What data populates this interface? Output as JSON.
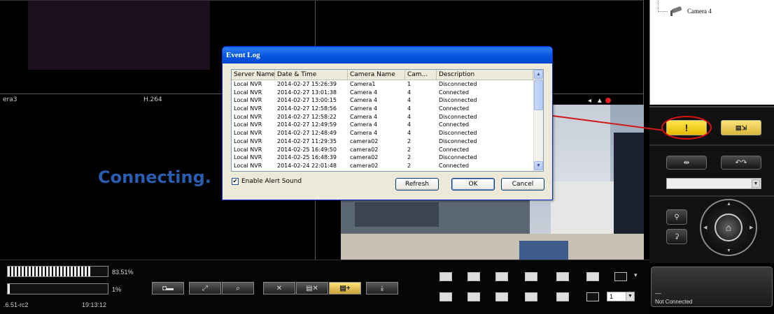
{
  "cameras": {
    "cam3_label": "era3",
    "cam3_codec": "H.264",
    "cam3_status": "Connecting."
  },
  "device_tree": {
    "item": "Camera 4"
  },
  "dialog": {
    "title": "Event Log",
    "columns": [
      "Server Name",
      "Date & Time",
      "Camera Name",
      "Cam...",
      "Description"
    ],
    "rows": [
      [
        "Local NVR",
        "2014-02-27 15:26:39",
        "Camera1",
        "1",
        "Disconnected"
      ],
      [
        "Local NVR",
        "2014-02-27 13:01:38",
        "Camera 4",
        "4",
        "Connected"
      ],
      [
        "Local NVR",
        "2014-02-27 13:00:15",
        "Camera 4",
        "4",
        "Disconnected"
      ],
      [
        "Local NVR",
        "2014-02-27 12:58:56",
        "Camera 4",
        "4",
        "Connected"
      ],
      [
        "Local NVR",
        "2014-02-27 12:58:22",
        "Camera 4",
        "4",
        "Disconnected"
      ],
      [
        "Local NVR",
        "2014-02-27 12:49:59",
        "Camera 4",
        "4",
        "Connected"
      ],
      [
        "Local NVR",
        "2014-02-27 12:48:49",
        "Camera 4",
        "4",
        "Disconnected"
      ],
      [
        "Local NVR",
        "2014-02-27 11:29:35",
        "camera02",
        "2",
        "Disconnected"
      ],
      [
        "Local NVR",
        "2014-02-25 16:49:50",
        "camera02",
        "2",
        "Connected"
      ],
      [
        "Local NVR",
        "2014-02-25 16:48:39",
        "camera02",
        "2",
        "Disconnected"
      ],
      [
        "Local NVR",
        "2014-02-24 22:01:48",
        "camera02",
        "2",
        "Connected"
      ]
    ],
    "checkbox_label": "Enable Alert Sound",
    "checkbox_checked": true,
    "refresh_label": "Refresh",
    "ok_label": "OK",
    "cancel_label": "Cancel"
  },
  "meters": {
    "top_percent_text": "83.51%",
    "top_value": 0.8351,
    "bottom_percent_text": "1%",
    "bottom_value": 0.01
  },
  "footer": {
    "version": ".6.51-rc2",
    "clock": "19:13:12"
  },
  "controls": {
    "alert_glyph": "!",
    "layout_number": "1",
    "status_dash": "—",
    "status_text": "Not Connected"
  },
  "icons": {
    "alert": "alert-icon",
    "event_list": "event-list-icon",
    "ptz_home": "home-icon",
    "record_dot_color": "#e02020"
  }
}
